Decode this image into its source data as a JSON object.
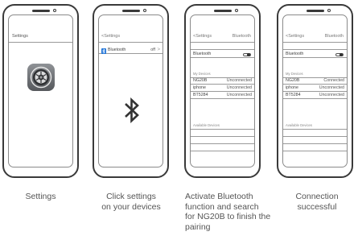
{
  "phones": [
    {
      "screen_title": "Settings"
    },
    {
      "back_label": "Settings",
      "bt_row_label": "Bluetooth",
      "bt_row_state": "off",
      "bt_row_chevron": ">"
    },
    {
      "back_label": "Settings",
      "nav_title": "Bluetooth",
      "bt_label": "Bluetooth",
      "my_devices_header": "My Devices",
      "devices": [
        {
          "name": "NG20B",
          "status": "Unconnected"
        },
        {
          "name": "iphone",
          "status": "Unconnected"
        },
        {
          "name": "BT5284",
          "status": "Unconnected"
        }
      ],
      "available_header": "Available Devices"
    },
    {
      "back_label": "Settings",
      "nav_title": "Bluetooth",
      "bt_label": "Bluetooth",
      "my_devices_header": "My Devices",
      "devices": [
        {
          "name": "NG20B",
          "status": "Connected"
        },
        {
          "name": "iphone",
          "status": "Unconnected"
        },
        {
          "name": "BT5284",
          "status": "Unconnected"
        }
      ],
      "available_header": "Available Devices"
    }
  ],
  "captions": [
    [
      "Settings"
    ],
    [
      "Click settings",
      "on your devices"
    ],
    [
      "Activate Bluetooth",
      "function and search",
      "for NG20B to finish the",
      "pairing"
    ],
    [
      "Connection",
      "successful"
    ]
  ],
  "icons": {
    "settings_app": "gear-icon",
    "bluetooth_large": "bluetooth-icon",
    "bluetooth_badge": "bluetooth-icon"
  },
  "colors": {
    "bluetooth_badge": "#1e73d8"
  }
}
